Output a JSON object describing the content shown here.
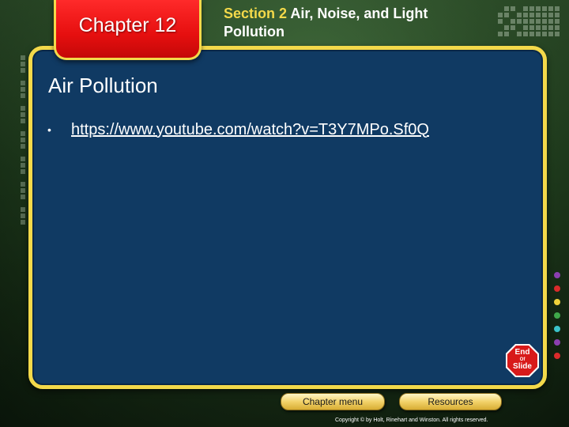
{
  "header": {
    "chapter_label": "Chapter 12",
    "section_number": "Section 2",
    "section_title": "Air, Noise, and Light Pollution"
  },
  "slide": {
    "title": "Air Pollution",
    "bullets": [
      {
        "text": "https://www.youtube.com/watch?v=T3Y7MPo.Sf0Q"
      }
    ]
  },
  "end_sign": {
    "line1": "End",
    "line2": "Of",
    "line3": "Slide"
  },
  "footer": {
    "chapter_menu_label": "Chapter menu",
    "resources_label": "Resources",
    "copyright": "Copyright © by Holt, Rinehart and Winston. All rights reserved."
  },
  "colors": {
    "panel_bg": "#103a63",
    "panel_border": "#f3d94a",
    "chapter_tab": "#e60f0f",
    "section_number": "#f3d94a"
  }
}
